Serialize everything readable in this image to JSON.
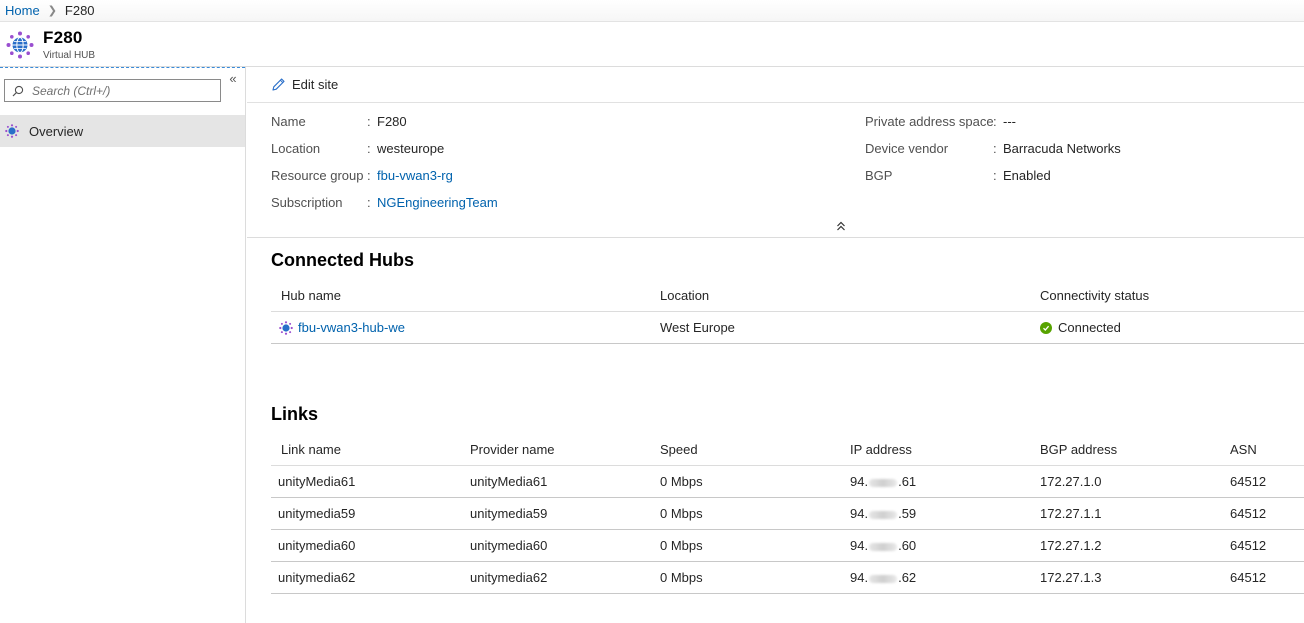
{
  "breadcrumb": {
    "home": "Home",
    "current": "F280"
  },
  "header": {
    "title": "F280",
    "subtitle": "Virtual HUB"
  },
  "sidebar": {
    "search_placeholder": "Search (Ctrl+/)",
    "collapse_glyph": "«",
    "items": [
      {
        "label": "Overview",
        "icon": "hub-icon",
        "selected": true
      }
    ]
  },
  "toolbar": {
    "edit_label": "Edit site"
  },
  "essentials": {
    "left": [
      {
        "label": "Name",
        "value": "F280",
        "link": false
      },
      {
        "label": "Location",
        "value": "westeurope",
        "link": false
      },
      {
        "label": "Resource group",
        "value": "fbu-vwan3-rg",
        "link": true
      },
      {
        "label": "Subscription",
        "value": "NGEngineeringTeam",
        "link": true
      }
    ],
    "right": [
      {
        "label": "Private address space",
        "value": "---"
      },
      {
        "label": "Device vendor",
        "value": "Barracuda Networks"
      },
      {
        "label": "BGP",
        "value": "Enabled"
      }
    ],
    "separator": ":"
  },
  "connected_hubs": {
    "title": "Connected Hubs",
    "columns": [
      "Hub name",
      "Location",
      "Connectivity status"
    ],
    "rows": [
      {
        "name": "fbu-vwan3-hub-we",
        "location": "West Europe",
        "status": "Connected"
      }
    ]
  },
  "links": {
    "title": "Links",
    "columns": [
      "Link name",
      "Provider name",
      "Speed",
      "IP address",
      "BGP address",
      "ASN"
    ],
    "rows": [
      {
        "name": "unityMedia61",
        "provider": "unityMedia61",
        "speed": "0 Mbps",
        "ip_prefix": "94.",
        "ip_suffix": ".61",
        "bgp": "172.27.1.0",
        "asn": "64512"
      },
      {
        "name": "unitymedia59",
        "provider": "unitymedia59",
        "speed": "0 Mbps",
        "ip_prefix": "94.",
        "ip_suffix": ".59",
        "bgp": "172.27.1.1",
        "asn": "64512"
      },
      {
        "name": "unitymedia60",
        "provider": "unitymedia60",
        "speed": "0 Mbps",
        "ip_prefix": "94.",
        "ip_suffix": ".60",
        "bgp": "172.27.1.2",
        "asn": "64512"
      },
      {
        "name": "unitymedia62",
        "provider": "unitymedia62",
        "speed": "0 Mbps",
        "ip_prefix": "94.",
        "ip_suffix": ".62",
        "bgp": "172.27.1.3",
        "asn": "64512"
      }
    ]
  },
  "colors": {
    "link": "#0062ad",
    "status_ok": "#57a300",
    "icon_blue": "#2a6fc9",
    "icon_purple": "#9a4fd0"
  }
}
